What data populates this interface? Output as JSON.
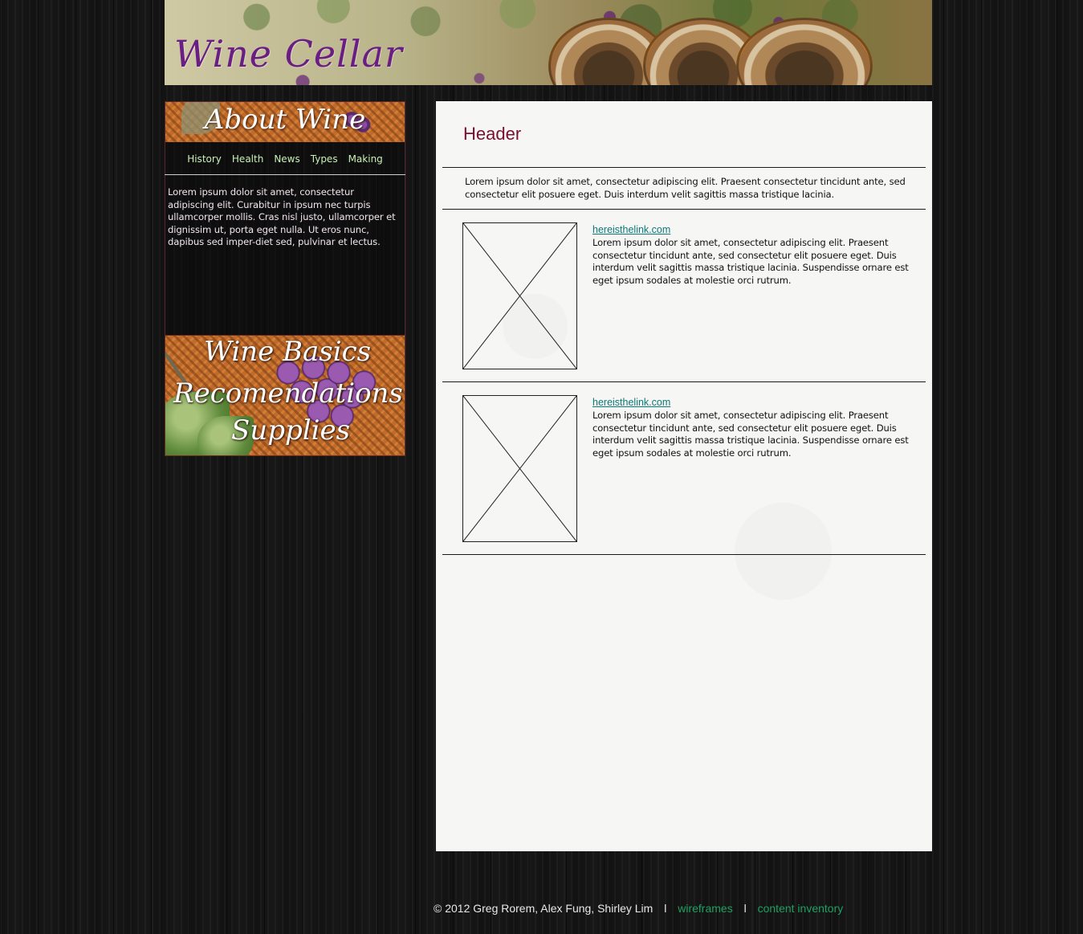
{
  "site": {
    "title": "Wine Cellar"
  },
  "sidebar": {
    "about_title": "About Wine",
    "nav": [
      "History",
      "Health",
      "News",
      "Types",
      "Making"
    ],
    "about_text": "Lorem ipsum dolor sit amet, consectetur adipiscing elit. Curabitur in ipsum nec turpis ullamcorper mollis. Cras nisl justo, ullamcorper et dignissim ut, porta eget nulla. Ut eros nunc, dapibus sed imper-diet sed, pulvinar et lectus.",
    "links": [
      "Wine Basics",
      "Recomendations",
      "Supplies"
    ]
  },
  "main": {
    "header": "Header",
    "intro": "Lorem ipsum dolor sit amet, consectetur adipiscing elit. Praesent consectetur tincidunt ante, sed consectetur elit posuere eget. Duis interdum velit sagittis massa tristique lacinia.",
    "articles": [
      {
        "link": "hereisthelink.com",
        "body": "Lorem ipsum dolor sit amet, consectetur adipiscing elit. Praesent consectetur tincidunt ante, sed consectetur elit posuere eget. Duis interdum velit sagittis massa tristique lacinia. Suspendisse ornare est eget ipsum sodales at molestie orci rutrum."
      },
      {
        "link": "hereisthelink.com",
        "body": "Lorem ipsum dolor sit amet, consectetur adipiscing elit. Praesent consectetur tincidunt ante, sed consectetur elit posuere eget. Duis interdum velit sagittis massa tristique lacinia. Suspendisse ornare est eget ipsum sodales at molestie orci rutrum."
      }
    ]
  },
  "footer": {
    "copyright": "© 2012 Greg Rorem, Alex Fung, Shirley Lim",
    "separator": "l",
    "wireframes": "wireframes",
    "content_inventory": "content inventory"
  },
  "colors": {
    "header_text": "#7a1030",
    "link_teal": "#0a7a78",
    "footer_link": "#1fa060",
    "nav_text": "#c9f0b5",
    "title_purple": "#6a1e84"
  }
}
